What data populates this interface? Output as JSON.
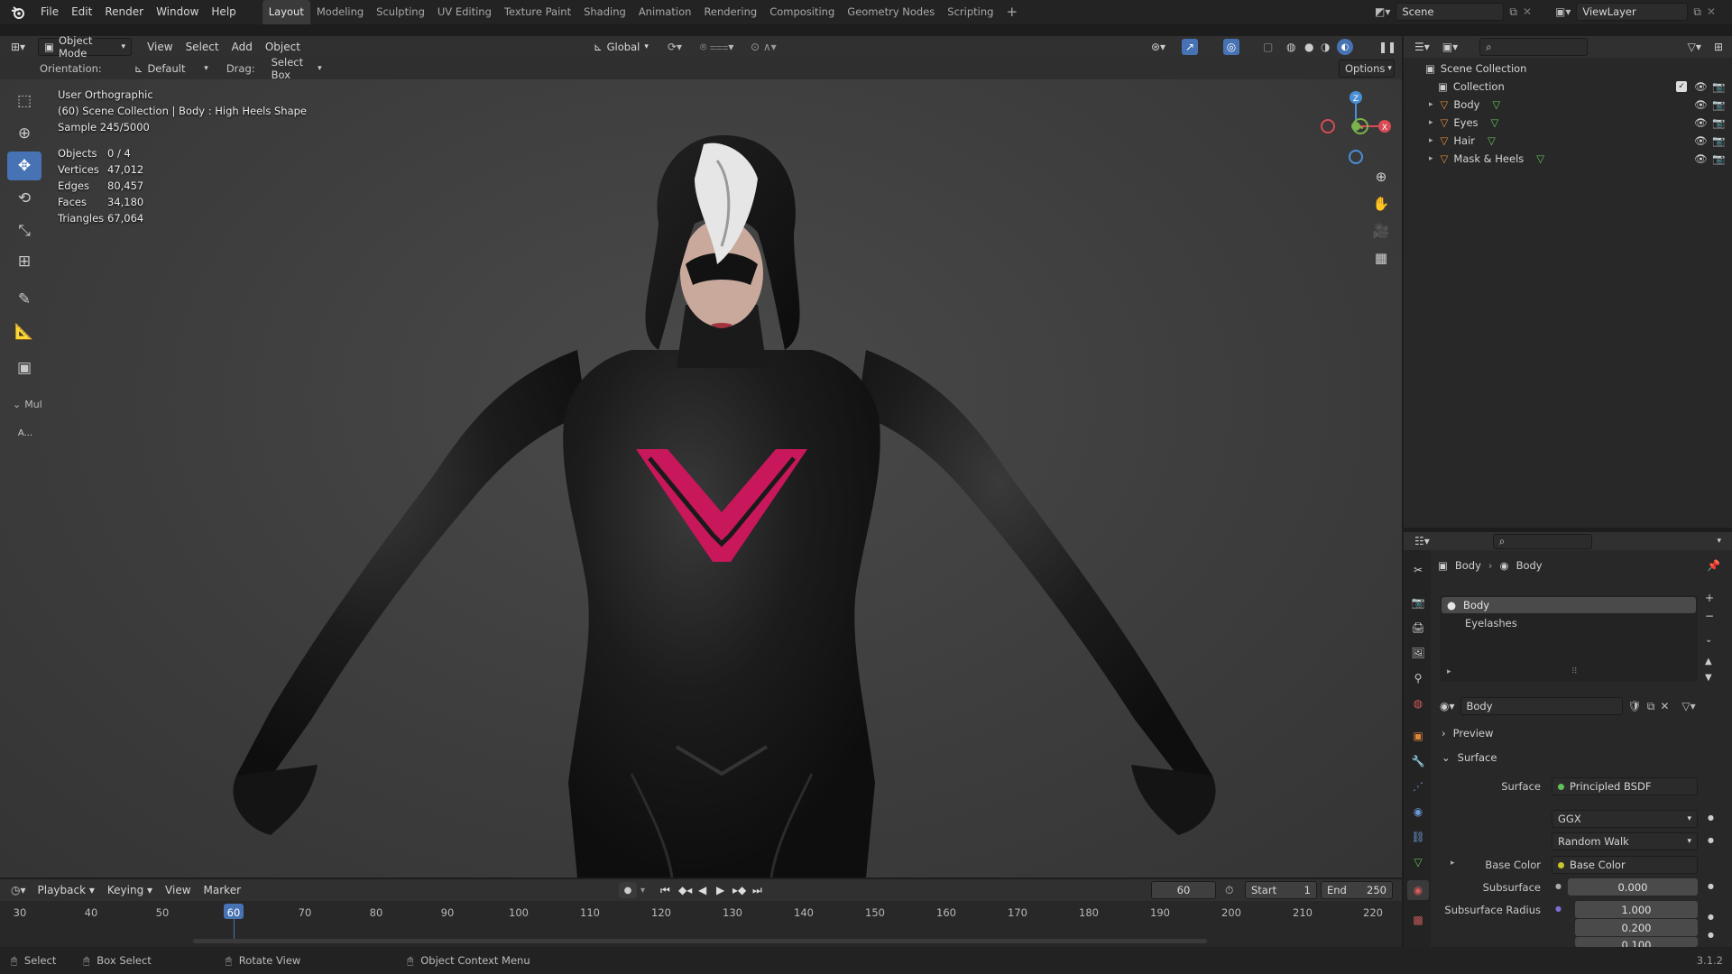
{
  "app": {
    "menus": [
      "File",
      "Edit",
      "Render",
      "Window",
      "Help"
    ],
    "workspaces": [
      "Layout",
      "Modeling",
      "Sculpting",
      "UV Editing",
      "Texture Paint",
      "Shading",
      "Animation",
      "Rendering",
      "Compositing",
      "Geometry Nodes",
      "Scripting"
    ],
    "active_workspace": "Layout",
    "scene": "Scene",
    "view_layer": "ViewLayer"
  },
  "viewport_header": {
    "mode": "Object Mode",
    "menus": [
      "View",
      "Select",
      "Add",
      "Object"
    ],
    "transform": "Global",
    "orientation_label": "Orientation:",
    "orientation": "Default",
    "drag_label": "Drag:",
    "drag": "Select Box",
    "options": "Options"
  },
  "overlay": {
    "view": "User Orthographic",
    "context": "(60) Scene Collection | Body : High Heels Shape",
    "sample": "Sample 245/5000",
    "stats": [
      {
        "label": "Objects",
        "value": "0 / 4"
      },
      {
        "label": "Vertices",
        "value": "47,012"
      },
      {
        "label": "Edges",
        "value": "80,457"
      },
      {
        "label": "Faces",
        "value": "34,180"
      },
      {
        "label": "Triangles",
        "value": "67,064"
      }
    ]
  },
  "toolbar_extra": {
    "panel": "Mul",
    "button": "A..."
  },
  "outliner": {
    "root": "Scene Collection",
    "collection": "Collection",
    "items": [
      "Body",
      "Eyes",
      "Hair",
      "Mask & Heels"
    ]
  },
  "properties": {
    "breadcrumb": [
      "Body",
      "Body"
    ],
    "material_slots": [
      "Body",
      "Eyelashes"
    ],
    "material": "Body",
    "panels": {
      "preview": "Preview",
      "surface": "Surface"
    },
    "rows": {
      "surface_label": "Surface",
      "surface_value": "Principled BSDF",
      "distribution": "GGX",
      "subsurface_method": "Random Walk",
      "base_color_label": "Base Color",
      "base_color_value": "Base Color",
      "subsurface_label": "Subsurface",
      "subsurface_value": "0.000",
      "radius_label": "Subsurface Radius",
      "radius_values": [
        "1.000",
        "0.200",
        "0.100"
      ]
    }
  },
  "timeline": {
    "menus": [
      "Playback",
      "Keying",
      "View",
      "Marker"
    ],
    "current_frame": "60",
    "start_label": "Start",
    "start": "1",
    "end_label": "End",
    "end": "250",
    "ticks": [
      "30",
      "40",
      "50",
      "60",
      "70",
      "80",
      "90",
      "100",
      "110",
      "120",
      "130",
      "140",
      "150",
      "160",
      "170",
      "180",
      "190",
      "200",
      "210",
      "220"
    ]
  },
  "statusbar": {
    "items": [
      "Select",
      "Box Select",
      "Rotate View",
      "Object Context Menu"
    ],
    "version": "3.1.2"
  },
  "colors": {
    "accent": "#4772b3",
    "suit_accent": "#c8175b",
    "outliner_orange": "#e0883a",
    "mesh_green": "#61c258"
  }
}
